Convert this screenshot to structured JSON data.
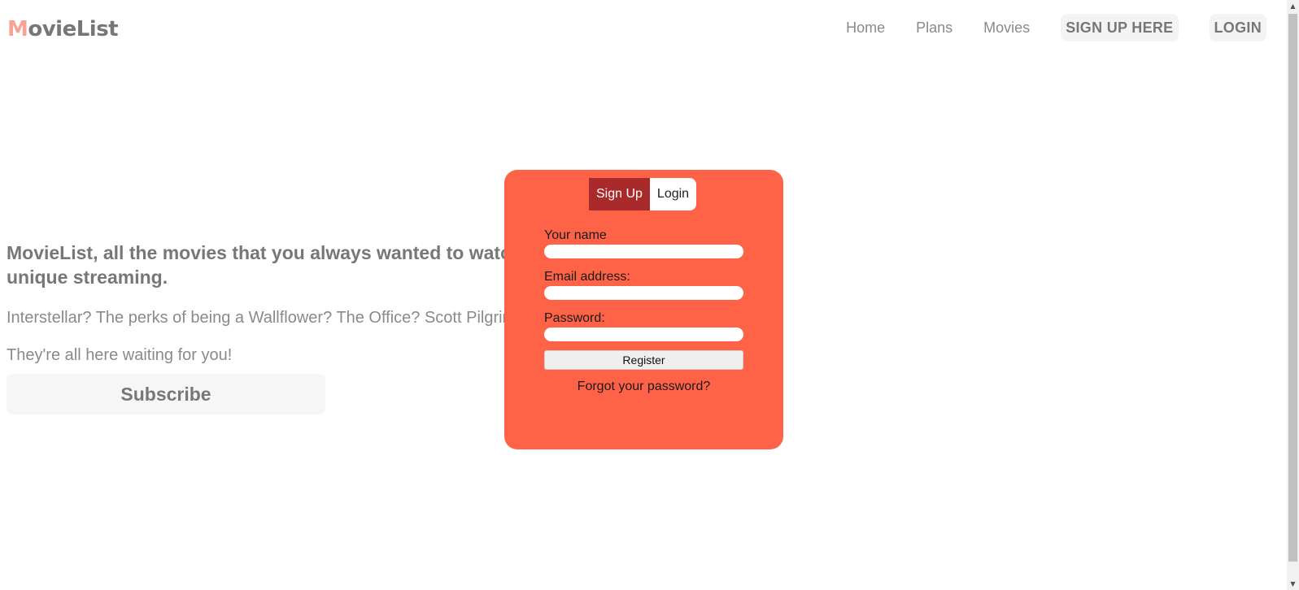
{
  "header": {
    "logo_first": "M",
    "logo_rest": "ovieList",
    "nav": {
      "home": "Home",
      "plans": "Plans",
      "movies": "Movies",
      "signup": "SIGN UP HERE",
      "login": "LOGIN"
    }
  },
  "hero": {
    "title": "MovieList, all the movies that you always wanted to watch in a unique streaming.",
    "subtitle1": "Interstellar? The perks of being a Wallflower? The Office? Scott Pilgrim?",
    "subtitle2": "They're all here waiting for you!",
    "subscribe_label": "Subscribe"
  },
  "modal": {
    "tab_signup": "Sign Up",
    "tab_login": "Login",
    "name_label": "Your name",
    "name_value": "",
    "email_label": "Email address:",
    "email_value": "",
    "password_label": "Password:",
    "password_value": "",
    "register_label": "Register",
    "forgot_label": "Forgot your password?"
  },
  "colors": {
    "modal_bg": "#ff6347",
    "tab_active": "#a92a2a",
    "logo_accent": "#f7a496",
    "text_gray": "#777777"
  },
  "icons": {
    "scroll_up": "triangle-up-icon",
    "scroll_down": "triangle-down-icon"
  }
}
